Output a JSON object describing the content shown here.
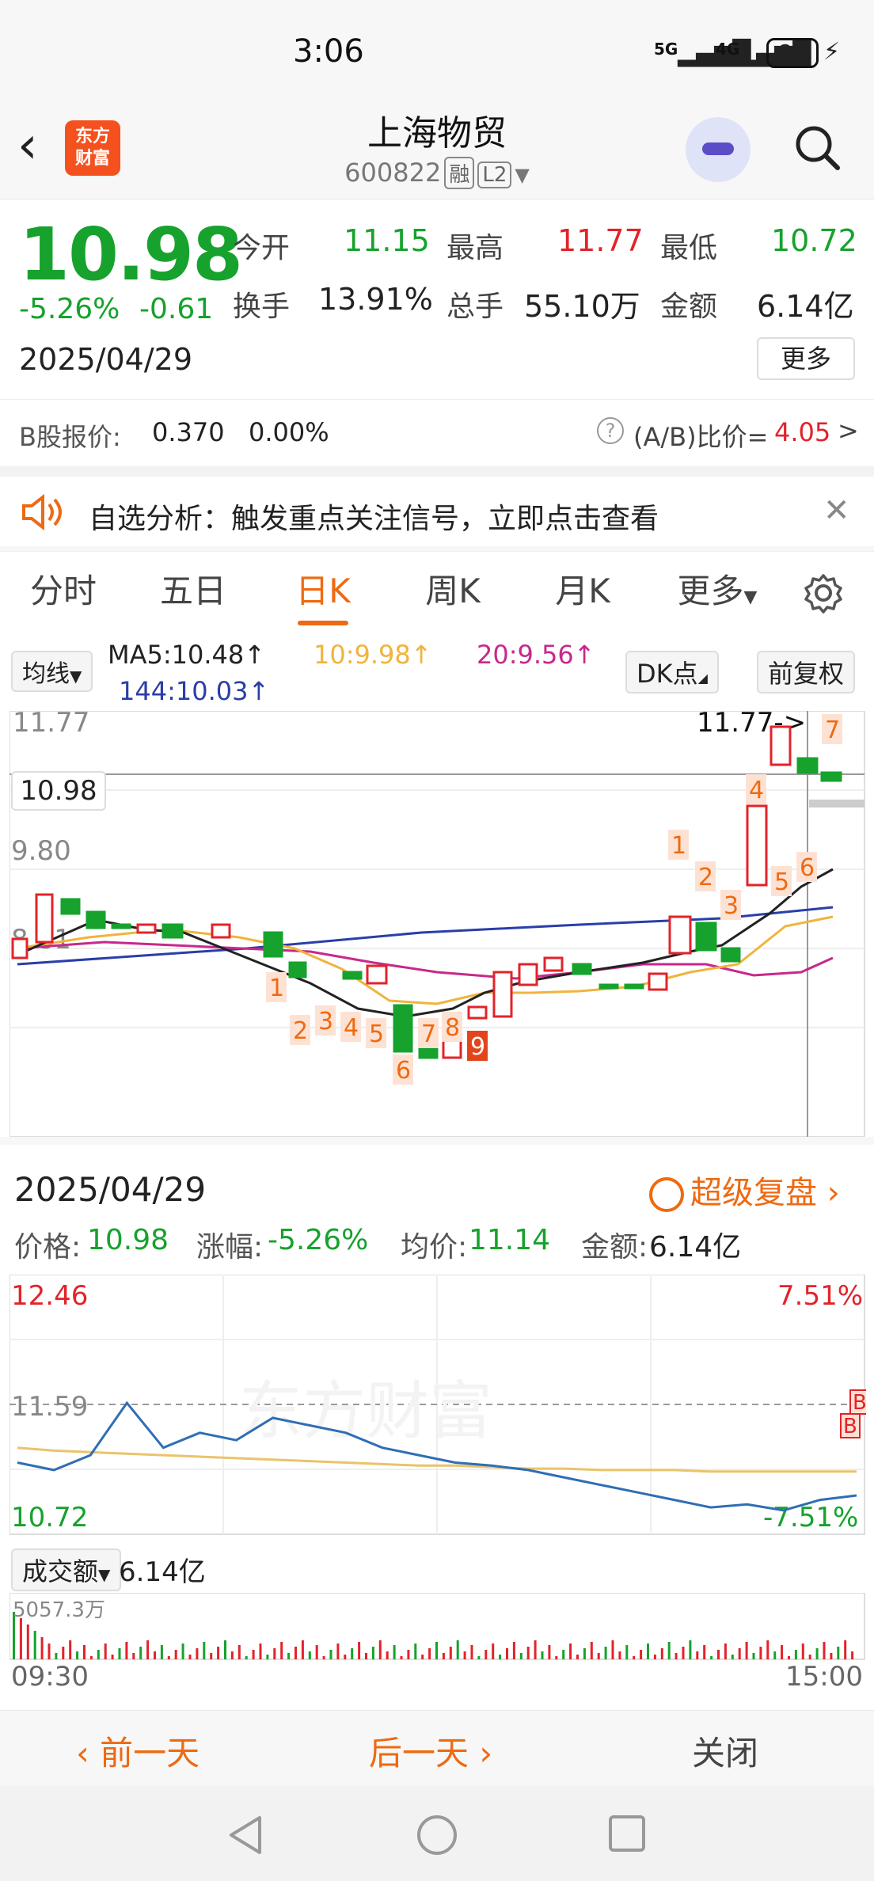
{
  "status": {
    "time": "3:06",
    "sig1": "5G",
    "sig2": "4G",
    "battery": "22"
  },
  "header": {
    "title": "上海物贸",
    "code": "600822",
    "tag_rong": "融",
    "tag_l2": "L2",
    "logo_top": "东方",
    "logo_bottom": "财富"
  },
  "quote": {
    "price": "10.98",
    "pct": "-5.26%",
    "change": "-0.61",
    "date": "2025/04/29",
    "open_label": "今开",
    "open": "11.15",
    "high_label": "最高",
    "high": "11.77",
    "low_label": "最低",
    "low": "10.72",
    "turnover_label": "换手",
    "turnover": "13.91%",
    "volume_label": "总手",
    "volume": "55.10万",
    "amount_label": "金额",
    "amount": "6.14亿",
    "more": "更多"
  },
  "bshare": {
    "label": "B股报价:",
    "price": "0.370",
    "pct": "0.00%",
    "ratio_label": "(A/B)比价=",
    "ratio": "4.05",
    "arrow": ">"
  },
  "notice": {
    "text": "自选分析：触发重点关注信号，立即点击查看",
    "close": "✕"
  },
  "tabs": [
    {
      "label": "分时"
    },
    {
      "label": "五日"
    },
    {
      "label": "日K"
    },
    {
      "label": "周K"
    },
    {
      "label": "月K"
    },
    {
      "label": "更多"
    }
  ],
  "kline": {
    "ma_selector": "均线",
    "ma5": "MA5:10.48↑",
    "ma10": "10:9.98↑",
    "ma20": "20:9.56↑",
    "ma144": "144:10.03↑",
    "dk_button": "DK点",
    "adjust_button": "前复权",
    "y_top": "11.77",
    "y_mid": "9.80",
    "y_low": "8.81",
    "price_tag": "10.98",
    "high_note": "11.77->",
    "colors": {
      "up": "#e2232a",
      "down": "#16a22d",
      "ma5": "#222222",
      "ma10": "#f0b43c",
      "ma20": "#c8288c",
      "ma144": "#2a3ea8"
    }
  },
  "kline_marks": {
    "m1": "1",
    "m2": "2",
    "m3": "3",
    "m4": "4",
    "m5": "5",
    "m6": "6",
    "m7": "7",
    "m8": "8",
    "m9": "9",
    "r1": "1",
    "r2": "2",
    "r3": "3",
    "r4": "4",
    "r5": "5",
    "r6": "6",
    "r7": "7"
  },
  "detail": {
    "date": "2025/04/29",
    "replay": "超级复盘",
    "price_label": "价格:",
    "price": "10.98",
    "pct_label": "涨幅:",
    "pct": "-5.26%",
    "avg_label": "均价:",
    "avg": "11.14",
    "amount_label": "金额:",
    "amount": "6.14亿",
    "y_high": "12.46",
    "y_high_pct": "7.51%",
    "y_mid": "11.59",
    "y_low": "10.72",
    "y_low_pct": "-7.51%",
    "watermark": "东方财富",
    "vol_selector": "成交额",
    "vol_total": "6.14亿",
    "vol_max": "5057.3万",
    "t_start": "09:30",
    "t_end": "15:00",
    "b_mark": "B"
  },
  "bottom": {
    "prev": "前一天",
    "next": "后一天",
    "close": "关闭"
  },
  "chart_data": {
    "type": "line",
    "title": "",
    "xlabel": "",
    "ylabel": "",
    "ylim": [
      10.72,
      12.46
    ],
    "x": [
      "09:30",
      "15:00"
    ],
    "series": [
      {
        "name": "价格",
        "values": [
          11.2,
          11.15,
          11.25,
          11.6,
          11.3,
          11.4,
          11.35,
          11.5,
          11.45,
          11.4,
          11.3,
          11.25,
          11.2,
          11.18,
          11.15,
          11.1,
          11.05,
          11.0,
          10.95,
          10.9,
          10.92,
          10.88,
          10.95,
          10.98
        ]
      },
      {
        "name": "均价",
        "values": [
          11.3,
          11.28,
          11.27,
          11.26,
          11.25,
          11.24,
          11.23,
          11.22,
          11.21,
          11.2,
          11.19,
          11.18,
          11.18,
          11.17,
          11.16,
          11.16,
          11.15,
          11.15,
          11.15,
          11.14,
          11.14,
          11.14,
          11.14,
          11.14
        ]
      }
    ]
  }
}
